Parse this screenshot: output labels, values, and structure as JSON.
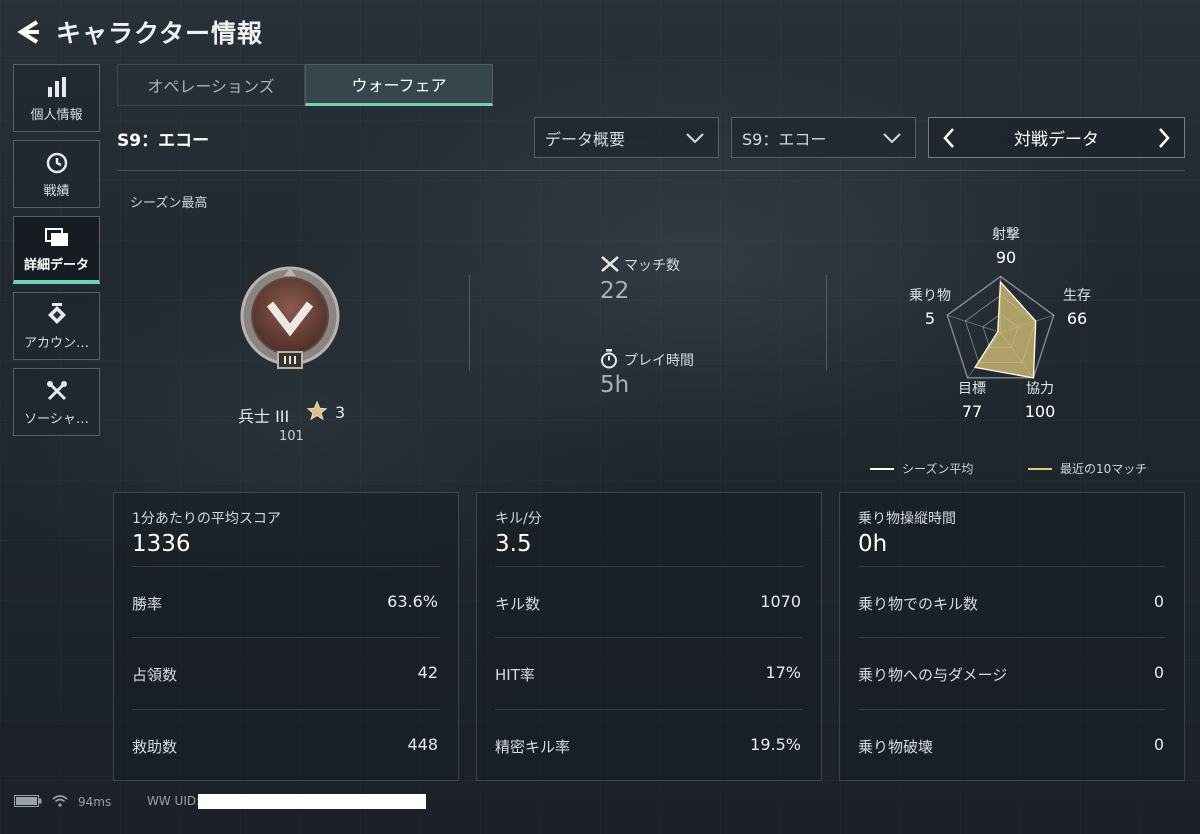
{
  "header": {
    "title": "キャラクター情報"
  },
  "sidebar": {
    "items": [
      {
        "label": "個人情報",
        "icon": "bar-chart-icon"
      },
      {
        "label": "戦績",
        "icon": "history-icon"
      },
      {
        "label": "詳細データ",
        "icon": "folder-icon",
        "active": true
      },
      {
        "label": "アカウン…",
        "icon": "account-badge-icon"
      },
      {
        "label": "ソーシャ…",
        "icon": "tools-icon"
      }
    ]
  },
  "tabs": [
    {
      "label": "オペレーションズ",
      "active": false
    },
    {
      "label": "ウォーフェア",
      "active": true
    }
  ],
  "season_title": "S9：エコー",
  "filters": {
    "data_type": "データ概要",
    "season": "S9：エコー",
    "mode": "対戦データ"
  },
  "overview": {
    "section_label": "シーズン最高",
    "rank": {
      "name": "兵士 III",
      "stars": "3",
      "level": "101"
    },
    "matches": {
      "label": "マッチ数",
      "value": "22"
    },
    "playtime": {
      "label": "プレイ時間",
      "value": "5h"
    }
  },
  "radar": {
    "labels": {
      "shooting": "射撃",
      "survival": "生存",
      "teamwork": "協力",
      "objective": "目標",
      "vehicle": "乗り物"
    },
    "values": {
      "shooting": "90",
      "survival": "66",
      "teamwork": "100",
      "objective": "77",
      "vehicle": "5"
    },
    "legend": {
      "season_avg": "シーズン平均",
      "recent": "最近の10マッチ"
    },
    "colors": {
      "season_avg": "#ffffff",
      "recent": "#e0c77a"
    }
  },
  "cards": [
    {
      "title": "1分あたりの平均スコア",
      "value": "1336",
      "rows": [
        {
          "label": "勝率",
          "value": "63.6%"
        },
        {
          "label": "占領数",
          "value": "42"
        },
        {
          "label": "救助数",
          "value": "448"
        }
      ]
    },
    {
      "title": "キル/分",
      "value": "3.5",
      "rows": [
        {
          "label": "キル数",
          "value": "1070"
        },
        {
          "label": "HIT率",
          "value": "17%"
        },
        {
          "label": "精密キル率",
          "value": "19.5%"
        }
      ]
    },
    {
      "title": "乗り物操縦時間",
      "value": "0h",
      "rows": [
        {
          "label": "乗り物でのキル数",
          "value": "0"
        },
        {
          "label": "乗り物への与ダメージ",
          "value": "0"
        },
        {
          "label": "乗り物破壊",
          "value": "0"
        }
      ]
    }
  ],
  "status": {
    "ping": "94ms",
    "uid_label": "WW UID:"
  },
  "accent": "#6fd4b4"
}
